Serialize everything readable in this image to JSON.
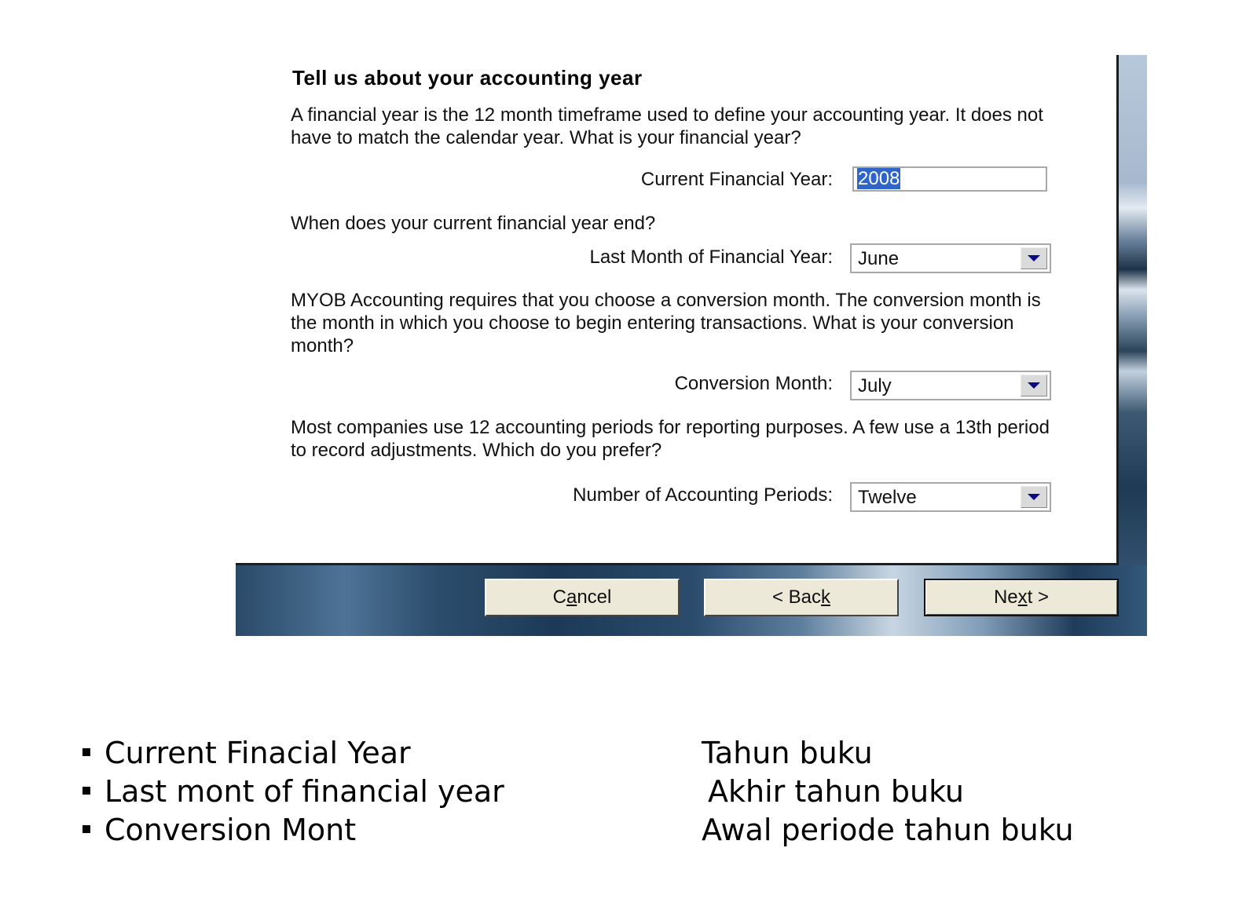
{
  "dialog": {
    "title": "Tell us about your accounting year",
    "paragraphs": [
      "A financial year is the 12 month timeframe used to define your accounting year.  It does not have to match the calendar year.  What is your financial year?",
      "When does your current financial year end?",
      "MYOB Accounting requires that you choose a conversion month.  The conversion month is the month in which you choose to begin entering transactions.  What is your conversion month?",
      "Most companies use 12 accounting periods for reporting purposes.  A few use a 13th period to record adjustments.  Which do you prefer?"
    ],
    "fields": {
      "current_financial_year": {
        "label": "Current Financial Year:",
        "value": "2008"
      },
      "last_month": {
        "label": "Last Month of Financial Year:",
        "value": "June",
        "icon": "dropdown-arrow-icon"
      },
      "conversion_month": {
        "label": "Conversion Month:",
        "value": "July",
        "icon": "dropdown-arrow-icon"
      },
      "accounting_periods": {
        "label": "Number of Accounting Periods:",
        "value": "Twelve",
        "icon": "dropdown-arrow-icon"
      }
    },
    "buttons": {
      "cancel": {
        "pre": "C",
        "accel": "a",
        "post": "ncel"
      },
      "back": {
        "pre": "< Bac",
        "accel": "k",
        "post": ""
      },
      "next": {
        "pre": "Ne",
        "accel": "x",
        "post": "t >"
      }
    }
  },
  "notes": {
    "terms": [
      "Current Finacial Year",
      "Last mont of financial year",
      "Conversion Mont"
    ],
    "translations": [
      "Tahun buku",
      "Akhir tahun buku",
      "Awal periode tahun buku"
    ]
  }
}
